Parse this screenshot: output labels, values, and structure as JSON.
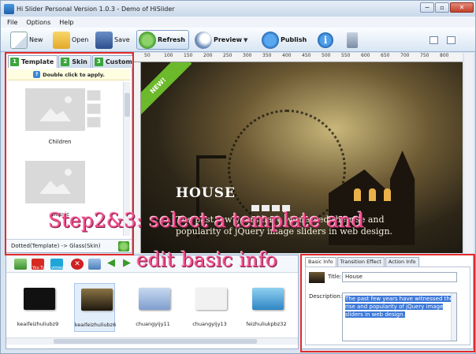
{
  "window": {
    "title": "Hi Slider Personal Version 1.0.3  -  Demo of HiSlider",
    "minimize": "−",
    "restore": "▫",
    "close": "✕"
  },
  "menu": [
    "File",
    "Options",
    "Help"
  ],
  "toolbar": {
    "new": "New",
    "open": "Open",
    "save": "Save",
    "refresh": "Refresh",
    "preview": "Preview",
    "publish": "Publish"
  },
  "left_panel": {
    "tabs": [
      {
        "num": "1",
        "label": "Template"
      },
      {
        "num": "2",
        "label": "Skin"
      },
      {
        "num": "3",
        "label": "Custom"
      }
    ],
    "hint": "Double click to apply.",
    "templates": [
      "Children",
      "Classic"
    ],
    "status": "Dotted(Template) -> Glass(Skin)"
  },
  "ruler": [
    "50",
    "100",
    "150",
    "200",
    "250",
    "300",
    "350",
    "400",
    "450",
    "500",
    "550",
    "600",
    "650",
    "700",
    "750",
    "800"
  ],
  "slide": {
    "ribbon": "NEW!",
    "title": "HOUSE",
    "description": "The past few years have witnessed the rise and popularity of jQuery image sliders in web design."
  },
  "caption": {
    "line1": "Step2&3: select a template and",
    "line2": "edit basic info"
  },
  "bottom_panel": {
    "tool_labels": {
      "youtube": "You Tube",
      "vimeo": "vimeo",
      "delete": "✕",
      "left": "◀",
      "right": "▶"
    },
    "thumbnails": [
      {
        "name": "keaifeizhuliubz9",
        "color": "#111111"
      },
      {
        "name": "keaifeizhuliubz6",
        "color": "#5a4a2a",
        "selected": true
      },
      {
        "name": "chuangyijy11",
        "color": "#8fb0d8"
      },
      {
        "name": "chuangyijy13",
        "color": "#eeeeee"
      },
      {
        "name": "feizhuliukpbz32",
        "color": "#4fa3d6"
      }
    ]
  },
  "info_panel": {
    "tabs": [
      "Basic Info",
      "Transition Effect",
      "Action Info"
    ],
    "title_label": "Title:",
    "title_value": "House",
    "desc_label": "Description:",
    "desc_value": "The past few years have witnessed the rise and popularity of jQuery image sliders in web design."
  }
}
